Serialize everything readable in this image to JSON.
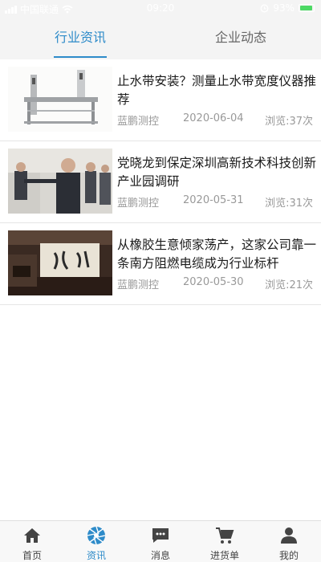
{
  "status_bar": {
    "carrier": "中国联通",
    "time": "09:20",
    "battery": "93%"
  },
  "tabs": [
    {
      "label": "行业资讯",
      "active": true
    },
    {
      "label": "企业动态",
      "active": false
    }
  ],
  "news": [
    {
      "title": "止水带安装？测量止水带宽度仪器推荐",
      "author": "蓝鹏测控",
      "date": "2020-06-04",
      "views": "浏览:37次"
    },
    {
      "title": "党晓龙到保定深圳高新技术科技创新产业园调研",
      "author": "蓝鹏测控",
      "date": "2020-05-31",
      "views": "浏览:31次"
    },
    {
      "title": "从橡胶生意倾家荡产，这家公司靠一条南方阻燃电缆成为行业标杆",
      "author": "蓝鹏测控",
      "date": "2020-05-30",
      "views": "浏览:21次"
    }
  ],
  "bottom_nav": [
    {
      "label": "首页",
      "icon": "home-icon",
      "active": false
    },
    {
      "label": "资讯",
      "icon": "aperture-icon",
      "active": true
    },
    {
      "label": "消息",
      "icon": "message-icon",
      "active": false
    },
    {
      "label": "进货单",
      "icon": "cart-icon",
      "active": false
    },
    {
      "label": "我的",
      "icon": "person-icon",
      "active": false
    }
  ],
  "colors": {
    "accent": "#2e8bc9",
    "header_bg": "#f4f4f4",
    "meta_text": "#999999"
  }
}
